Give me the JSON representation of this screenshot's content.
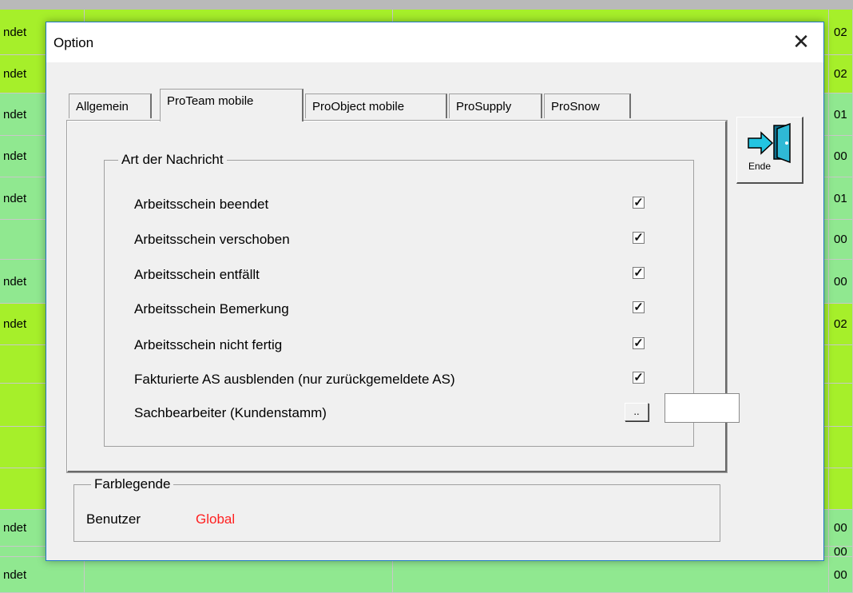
{
  "background": {
    "rows": [
      {
        "c1": "ndet",
        "c4": "02",
        "style": "lime"
      },
      {
        "c1": "ndet",
        "c4": "02",
        "style": "lime"
      },
      {
        "c1": "ndet",
        "c4": "01",
        "style": "green"
      },
      {
        "c1": "ndet",
        "c4": "00",
        "style": "green"
      },
      {
        "c1": "ndet",
        "c4": "01",
        "style": "green"
      },
      {
        "c1": "",
        "c4": "00",
        "style": "green"
      },
      {
        "c1": "ndet",
        "c4": "00",
        "style": "green"
      },
      {
        "c1": "ndet",
        "c4": "02",
        "style": "lime"
      },
      {
        "c1": "",
        "c4": "",
        "style": "lime"
      },
      {
        "c1": "",
        "c4": "",
        "style": "lime"
      },
      {
        "c1": "",
        "c4": "",
        "style": "lime"
      },
      {
        "c1": "",
        "c4": "",
        "style": "lime"
      },
      {
        "c1": "ndet",
        "c4": "00",
        "style": "green"
      },
      {
        "c1": "",
        "c4": "00",
        "style": "green"
      },
      {
        "c1": "ndet",
        "c4": "00",
        "style": "green"
      }
    ]
  },
  "dialog": {
    "title": "Option",
    "close_glyph": "✕",
    "tabs": [
      {
        "label": "Allgemein",
        "active": false
      },
      {
        "label": "ProTeam mobile",
        "active": true
      },
      {
        "label": "ProObject mobile",
        "active": false
      },
      {
        "label": "ProSupply",
        "active": false
      },
      {
        "label": "ProSnow",
        "active": false
      }
    ],
    "group_title": "Art der Nachricht",
    "options": [
      {
        "label": "Arbeitsschein beendet",
        "checked": true
      },
      {
        "label": "Arbeitsschein verschoben",
        "checked": true
      },
      {
        "label": "Arbeitsschein entfällt",
        "checked": true
      },
      {
        "label": "Arbeitsschein Bemerkung",
        "checked": true
      },
      {
        "label": "Arbeitsschein nicht fertig",
        "checked": true
      },
      {
        "label": "Fakturierte AS ausblenden (nur zurückgemeldete AS)",
        "checked": true
      }
    ],
    "sachbearbeiter": {
      "label": "Sachbearbeiter (Kundenstamm)",
      "button": "..",
      "value": ""
    },
    "exit_button": {
      "label": "Ende",
      "icon": "exit-door-icon"
    },
    "legend": {
      "title": "Farblegende",
      "user": "Benutzer",
      "global": "Global",
      "global_color": "#ff2020"
    }
  }
}
